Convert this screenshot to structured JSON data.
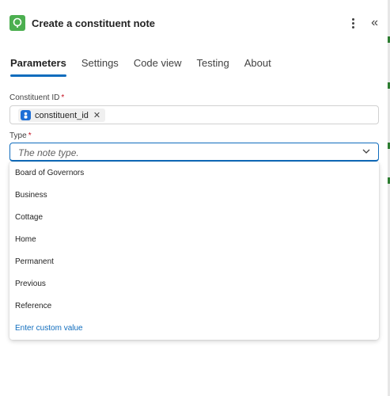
{
  "header": {
    "title": "Create a constituent note"
  },
  "tabs": [
    {
      "label": "Parameters",
      "active": true
    },
    {
      "label": "Settings",
      "active": false
    },
    {
      "label": "Code view",
      "active": false
    },
    {
      "label": "Testing",
      "active": false
    },
    {
      "label": "About",
      "active": false
    }
  ],
  "constituent_id": {
    "label": "Constituent ID",
    "required_mark": "*",
    "token_label": "constituent_id",
    "token_close": "✕"
  },
  "type_field": {
    "label": "Type",
    "required_mark": "*",
    "placeholder": "The note type."
  },
  "dropdown": {
    "options": [
      "Board of Governors",
      "Business",
      "Cottage",
      "Home",
      "Permanent",
      "Previous",
      "Reference"
    ],
    "custom_value": "Enter custom value"
  },
  "colors": {
    "accent": "#0f6cbd",
    "app_icon": "#4caf50",
    "required": "#c50f1f",
    "token_icon": "#1e6fd6"
  }
}
